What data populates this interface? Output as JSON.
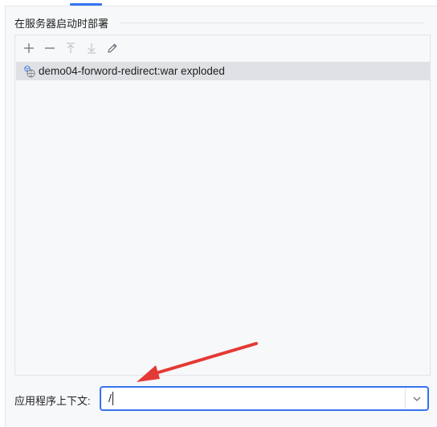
{
  "section": {
    "title": "在服务器启动时部署"
  },
  "toolbar": {
    "add_icon": "plus-icon",
    "remove_icon": "minus-icon",
    "move_up_icon": "arrow-up-icon",
    "move_down_icon": "arrow-down-icon",
    "edit_icon": "pencil-icon"
  },
  "artifacts": [
    {
      "label": "demo04-forword-redirect:war exploded",
      "icon": "artifact-icon",
      "selected": true
    }
  ],
  "context": {
    "label": "应用程序上下文:",
    "value": "/"
  },
  "colors": {
    "accent": "#3574f0",
    "annotation_arrow": "#e53935",
    "selection": "#dfe1e5",
    "panel_bg": "#f7f8fa"
  }
}
